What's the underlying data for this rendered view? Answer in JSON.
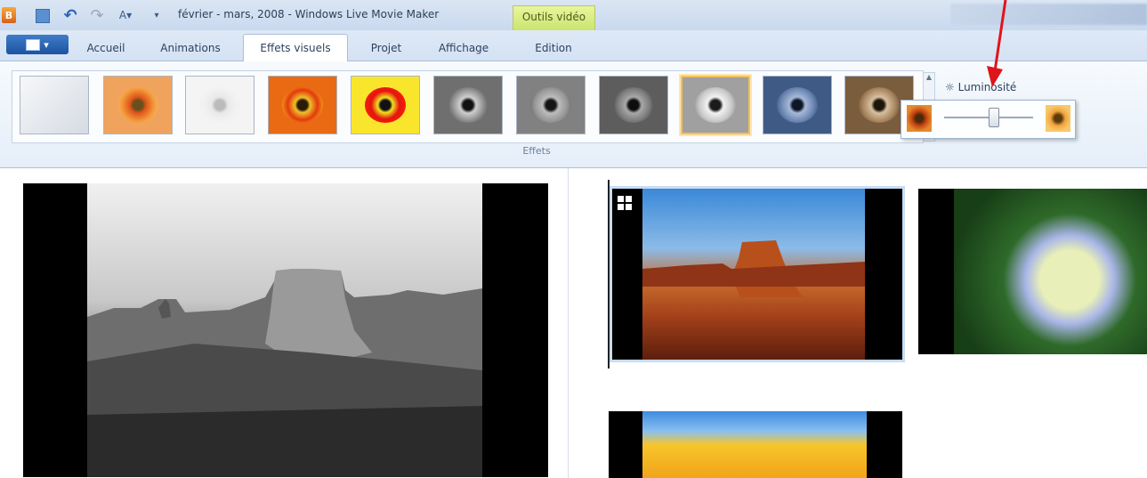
{
  "title_bar": {
    "window_title": "février - mars, 2008 - Windows Live Movie Maker",
    "contextual_tab_group": "Outils vidéo"
  },
  "tabs": [
    {
      "label": "Accueil",
      "active": false
    },
    {
      "label": "Animations",
      "active": false
    },
    {
      "label": "Effets visuels",
      "active": true
    },
    {
      "label": "Projet",
      "active": false
    },
    {
      "label": "Affichage",
      "active": false
    },
    {
      "label": "Edition",
      "active": false
    }
  ],
  "ribbon": {
    "group_label": "Effets",
    "brightness_label": "Luminosité",
    "brightness_level_fraction": 0.55,
    "selected_effect_index": 8,
    "effects": [
      {
        "name": "none",
        "style": "none"
      },
      {
        "name": "color",
        "style": "color"
      },
      {
        "name": "faded",
        "style": "faded"
      },
      {
        "name": "color-bright",
        "style": "color-bright"
      },
      {
        "name": "saturated",
        "style": "saturated"
      },
      {
        "name": "grayscale-1",
        "style": "gray-dark"
      },
      {
        "name": "grayscale-2",
        "style": "gray-mid"
      },
      {
        "name": "grayscale-3",
        "style": "gray-dark2"
      },
      {
        "name": "grayscale-selected",
        "style": "gray-light"
      },
      {
        "name": "cyanotype",
        "style": "blue"
      },
      {
        "name": "sepia",
        "style": "sepia"
      }
    ]
  },
  "colors": {
    "accent_selected": "#f1c15d",
    "arrow": "#e0141b",
    "contextual_tab": "#cbe470"
  },
  "icons": {
    "app": "movie-maker-icon",
    "save": "save-icon",
    "undo": "undo-icon",
    "redo": "redo-icon",
    "brightness": "sun-icon"
  }
}
